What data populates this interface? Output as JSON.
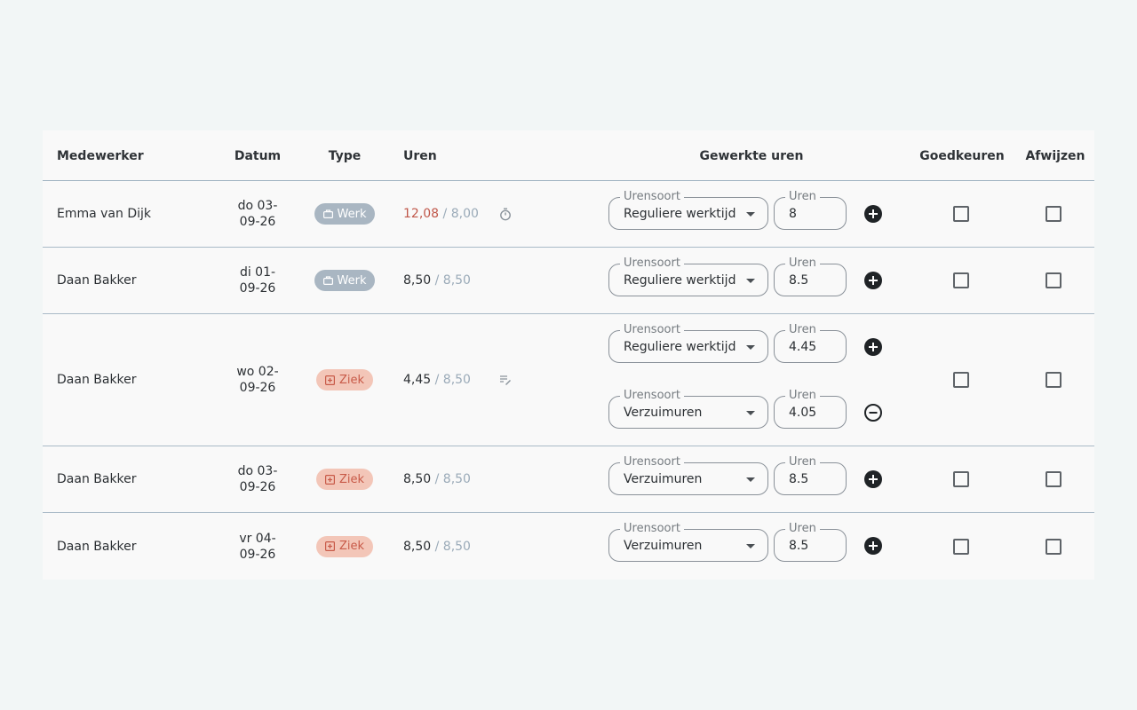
{
  "header": {
    "employee": "Medewerker",
    "date": "Datum",
    "type": "Type",
    "hours": "Uren",
    "worked": "Gewerkte uren",
    "approve": "Goedkeuren",
    "reject": "Afwijzen"
  },
  "field_labels": {
    "hour_type": "Urensoort",
    "hours": "Uren"
  },
  "colors": {
    "werk_badge": "#a9b6c2",
    "ziek_badge": "#f3c6b8",
    "over_hours": "#c0574a"
  },
  "rows": [
    {
      "employee": "Emma van Dijk",
      "date_line1": "do 03-",
      "date_line2": "09-26",
      "type": "Werk",
      "type_icon": "briefcase-icon",
      "hours": "12,08",
      "target": "/ 8,00",
      "over": true,
      "status_icon": "stopwatch-icon",
      "entries": [
        {
          "hour_type": "Reguliere werktijd",
          "hours": "8",
          "action": "add-icon"
        }
      ],
      "approve": false,
      "reject": false
    },
    {
      "employee": "Daan Bakker",
      "date_line1": "di 01-",
      "date_line2": "09-26",
      "type": "Werk",
      "type_icon": "briefcase-icon",
      "hours": "8,50",
      "target": "/ 8,50",
      "over": false,
      "status_icon": "",
      "entries": [
        {
          "hour_type": "Reguliere werktijd",
          "hours": "8.5",
          "action": "add-icon"
        }
      ],
      "approve": false,
      "reject": false
    },
    {
      "employee": "Daan Bakker",
      "date_line1": "wo 02-",
      "date_line2": "09-26",
      "type": "Ziek",
      "type_icon": "medical-icon",
      "hours": "4,45",
      "target": "/ 8,50",
      "over": false,
      "status_icon": "edit-note-icon",
      "entries": [
        {
          "hour_type": "Reguliere werktijd",
          "hours": "4.45",
          "action": "add-icon"
        },
        {
          "hour_type": "Verzuimuren",
          "hours": "4.05",
          "action": "remove-icon"
        }
      ],
      "approve": false,
      "reject": false
    },
    {
      "employee": "Daan Bakker",
      "date_line1": "do 03-",
      "date_line2": "09-26",
      "type": "Ziek",
      "type_icon": "medical-icon",
      "hours": "8,50",
      "target": "/ 8,50",
      "over": false,
      "status_icon": "",
      "entries": [
        {
          "hour_type": "Verzuimuren",
          "hours": "8.5",
          "action": "add-icon"
        }
      ],
      "approve": false,
      "reject": false
    },
    {
      "employee": "Daan Bakker",
      "date_line1": "vr 04-",
      "date_line2": "09-26",
      "type": "Ziek",
      "type_icon": "medical-icon",
      "hours": "8,50",
      "target": "/ 8,50",
      "over": false,
      "status_icon": "",
      "entries": [
        {
          "hour_type": "Verzuimuren",
          "hours": "8.5",
          "action": "add-icon"
        }
      ],
      "approve": false,
      "reject": false
    }
  ]
}
